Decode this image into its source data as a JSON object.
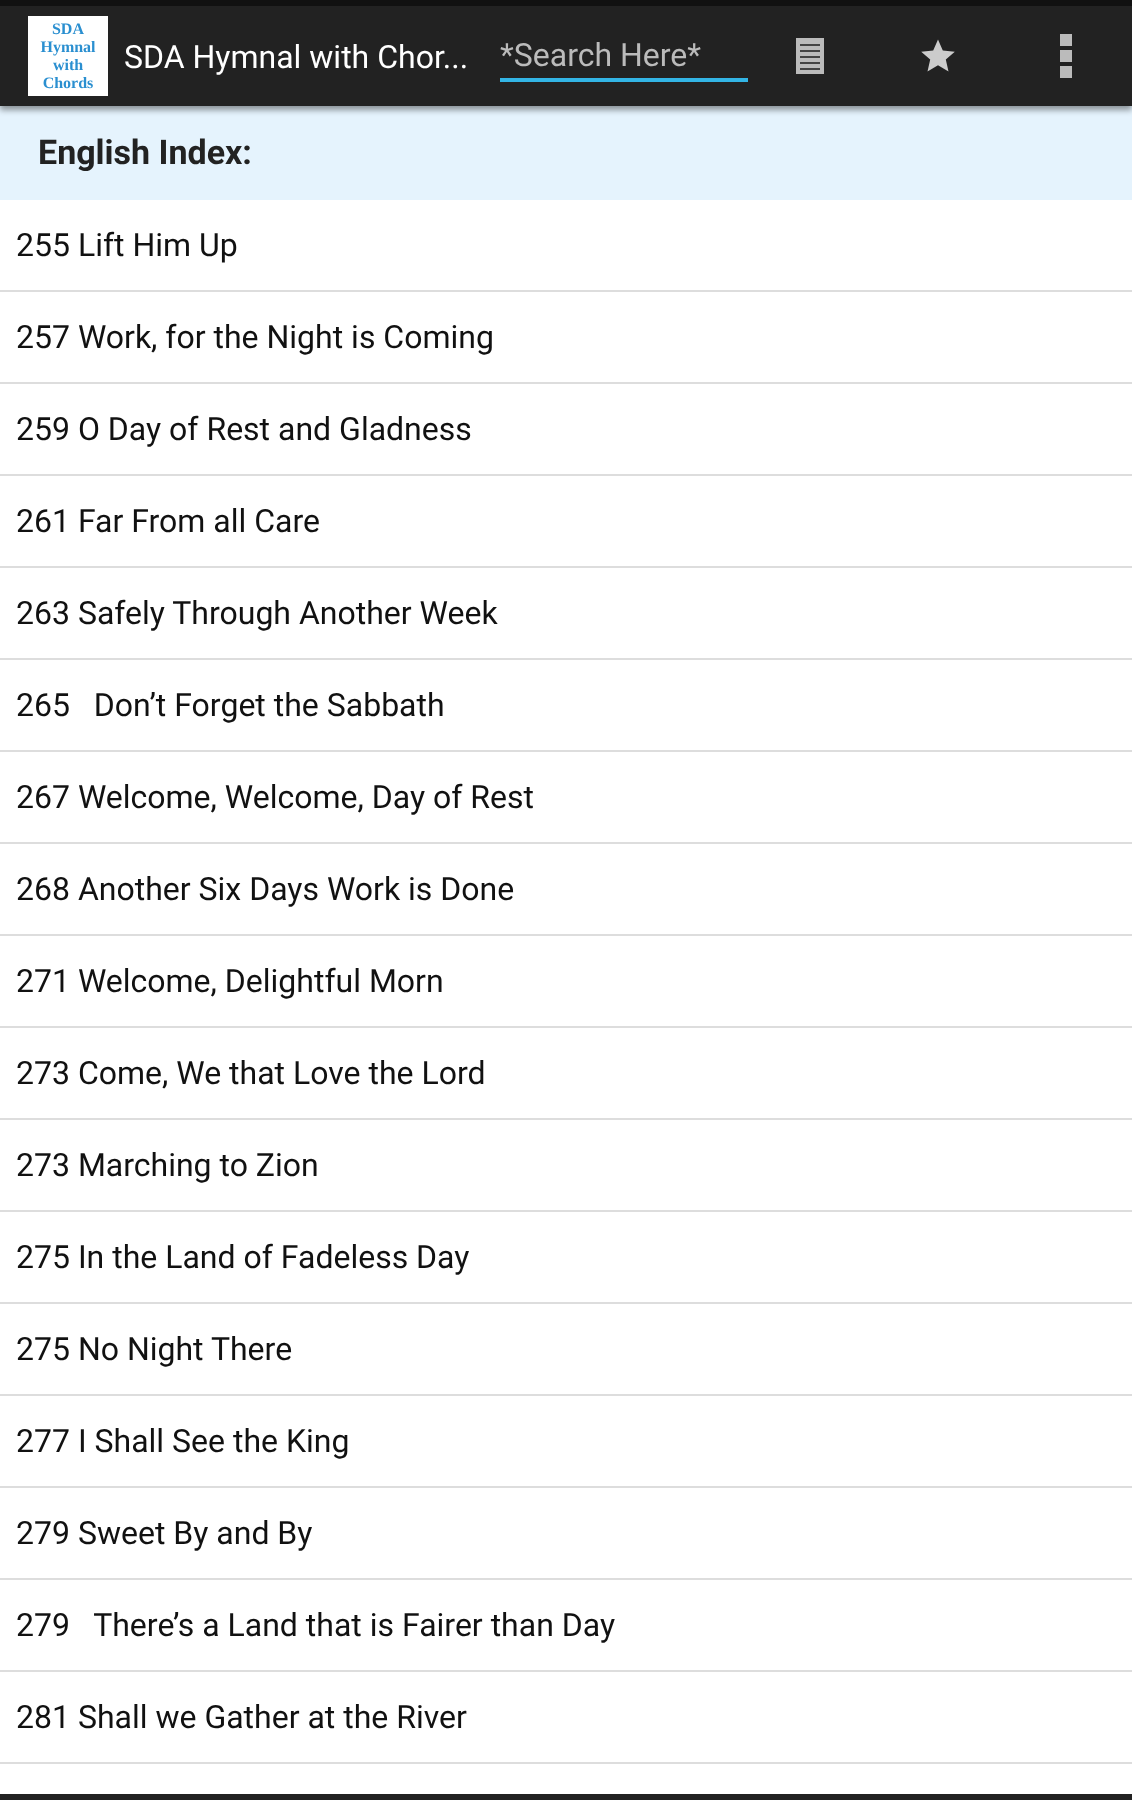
{
  "app_bar": {
    "logo_lines": [
      "SDA",
      "Hymnal",
      "with",
      "Chords"
    ],
    "title": "SDA Hymnal with Chor...",
    "search": {
      "placeholder": "*Search Here*"
    }
  },
  "section_title": "English Index:",
  "hymns": [
    "255 Lift Him Up",
    "257 Work, for the Night is Coming",
    "259 O Day of Rest and Gladness",
    "261 Far From all Care",
    "263 Safely Through Another Week",
    "265   Don’t Forget the Sabbath",
    "267 Welcome, Welcome, Day of Rest",
    "268 Another Six Days Work is Done",
    "271 Welcome, Delightful Morn",
    "273 Come, We that Love the Lord",
    "273 Marching to Zion",
    "275 In the Land of Fadeless Day",
    "275 No Night There",
    "277 I Shall See the King",
    "279 Sweet By and By",
    "279   There’s a Land that is Fairer than Day",
    "281 Shall we Gather at the River"
  ]
}
